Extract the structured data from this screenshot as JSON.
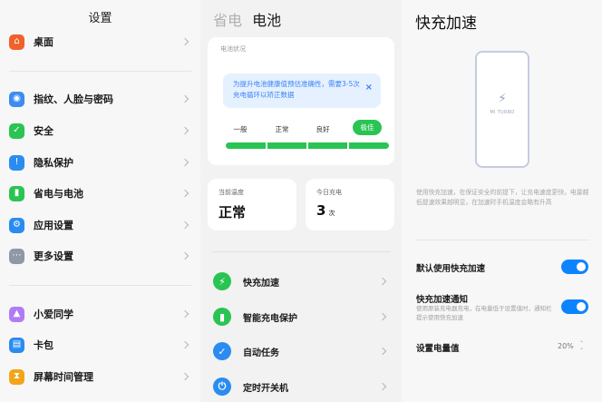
{
  "settings": {
    "title": "设置",
    "items": [
      {
        "label": "桌面",
        "icon": "home-icon",
        "color": "#f0612b",
        "glyph": "⌂"
      },
      {
        "label": "指纹、人脸与密码",
        "icon": "fingerprint-icon",
        "color": "#3d8cf0",
        "glyph": "◉"
      },
      {
        "label": "安全",
        "icon": "shield-icon",
        "color": "#2ac453",
        "glyph": "✓"
      },
      {
        "label": "隐私保护",
        "icon": "privacy-icon",
        "color": "#2a8cf0",
        "glyph": "!"
      },
      {
        "label": "省电与电池",
        "icon": "battery-icon",
        "color": "#2ac453",
        "glyph": "▮"
      },
      {
        "label": "应用设置",
        "icon": "gear-icon",
        "color": "#2a8cf0",
        "glyph": "⚙"
      },
      {
        "label": "更多设置",
        "icon": "more-icon",
        "color": "#8e98a6",
        "glyph": "⋯"
      },
      {
        "label": "小爱同学",
        "icon": "xiaoai-icon",
        "color": "#b07cf5",
        "glyph": "▲"
      },
      {
        "label": "卡包",
        "icon": "wallet-icon",
        "color": "#2a8cf0",
        "glyph": "▤"
      },
      {
        "label": "屏幕时间管理",
        "icon": "hourglass-icon",
        "color": "#f2a51a",
        "glyph": "⧗"
      }
    ]
  },
  "battery": {
    "tab_inactive": "省电",
    "tab_active": "电池",
    "status_title": "电池状况",
    "tip": "为提升电池健康值预估准确性，需要3-5次充电循环以矫正数据",
    "tip_close": "×",
    "levels": [
      "一般",
      "正常",
      "良好",
      "极佳"
    ],
    "selected_level": "极佳",
    "health_fraction": 1.0,
    "temp_label": "当前温度",
    "temp_value": "正常",
    "charge_label": "今日充电",
    "charge_value": "3",
    "charge_unit": "次",
    "features": [
      {
        "label": "快充加速",
        "icon": "bolt-icon",
        "color": "#2ac453",
        "glyph": "⚡"
      },
      {
        "label": "智能充电保护",
        "icon": "charge-protect-icon",
        "color": "#2ac453",
        "glyph": "▮"
      },
      {
        "label": "自动任务",
        "icon": "task-icon",
        "color": "#2a8cf0",
        "glyph": "✓"
      },
      {
        "label": "定时开关机",
        "icon": "power-icon",
        "color": "#2a8cf0",
        "glyph": "⏻"
      }
    ]
  },
  "fastcharge": {
    "title": "快充加速",
    "phone_bolt": "⚡",
    "phone_brand": "MI TURBO",
    "description": "使用快充加速，在保证安全的前提下，让充电速度更快，电量越低提速效果越明显，在加速时手机温度会略有升高",
    "default_label": "默认使用快充加速",
    "default_on": true,
    "notify_label": "快充加速通知",
    "notify_desc": "使用原装充电器充电，在电量低于设置值时，通知栏提示使用快充加速",
    "notify_on": true,
    "level_label": "设置电量值",
    "level_value": "20%",
    "level_arrows": "⌃⌄"
  }
}
